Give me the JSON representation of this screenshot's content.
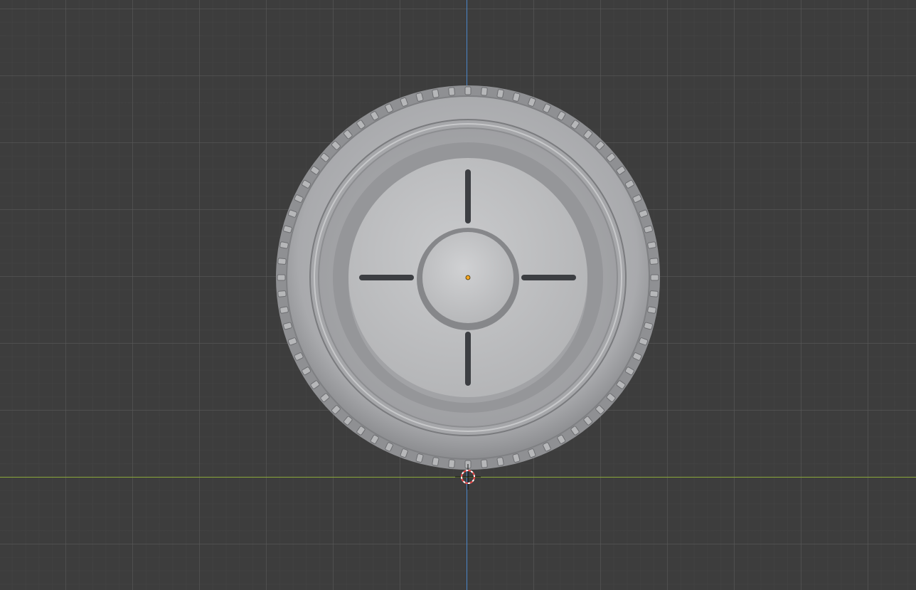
{
  "app": {
    "name": "",
    "view": "3d-viewport"
  },
  "viewport": {
    "background_color": "#3d3d3d",
    "grid_major_color": "#5a5a5a",
    "grid_minor_color": "#464646",
    "axis_z_color": "#4a86c8",
    "axis_x_color": "#8aa63a"
  },
  "scene": {
    "objects": [
      {
        "name": "",
        "kind": "wheel-mesh",
        "parts": [
          "tire-tread",
          "tire-sidewall",
          "rim",
          "hub-cap",
          "spoke-slots"
        ],
        "material_color": "#b8b9bb",
        "origin_marker_color": "#f5a623"
      }
    ],
    "cursor_3d": {
      "icon": "3d-cursor-icon",
      "colors": [
        "#e23b3b",
        "#ffffff"
      ]
    }
  }
}
